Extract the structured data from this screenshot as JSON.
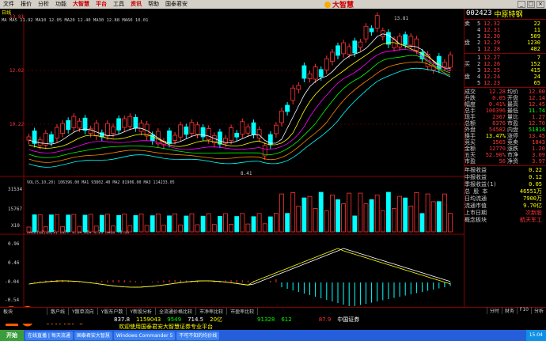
{
  "menu": {
    "items": [
      "文件",
      "报价",
      "分析",
      "功能",
      "大智慧",
      "平台",
      "工具",
      "资讯",
      "帮助",
      "国泰君安"
    ],
    "logo": "大智慧"
  },
  "chart": {
    "title": "日线",
    "ma_label": "MA MA5 11.92 MA10 12.05 MA20 12.40 MA30 12.88 MA60 10.01",
    "vol_label": "VOL(5,10,20)  106396.00  MA1 93802.40  MA2 81906.00  MA3 114233.05",
    "macd_label": "MACD(12,26,9)  DIFF 0.14  DEA 0.29  MACD -0.30",
    "price_axis": [
      "13.81",
      "12.02",
      "10.22"
    ],
    "vol_axis": [
      "31534",
      "15767",
      "X10"
    ],
    "macd_axis": [
      "0.96",
      "0.46",
      "-0.04",
      "-0.54"
    ],
    "high_label": "13.81",
    "low_label": "8.41"
  },
  "quote": {
    "code": "002423",
    "name": "中原特钢",
    "sell": [
      {
        "label": "卖",
        "idx": "5",
        "price": "12.32",
        "vol": "22"
      },
      {
        "label": "",
        "idx": "4",
        "price": "12.31",
        "vol": "11"
      },
      {
        "label": "",
        "idx": "3",
        "price": "12.30",
        "vol": "509"
      },
      {
        "label": "盘",
        "idx": "2",
        "price": "12.29",
        "vol": "1230"
      },
      {
        "label": "",
        "idx": "1",
        "price": "12.28",
        "vol": "482"
      }
    ],
    "buy": [
      {
        "label": "",
        "idx": "1",
        "price": "12.27",
        "vol": "7"
      },
      {
        "label": "买",
        "idx": "2",
        "price": "12.26",
        "vol": "152"
      },
      {
        "label": "",
        "idx": "3",
        "price": "12.25",
        "vol": "415"
      },
      {
        "label": "盘",
        "idx": "4",
        "price": "12.24",
        "vol": "24"
      },
      {
        "label": "",
        "idx": "5",
        "price": "12.23",
        "vol": "65"
      }
    ],
    "stats": [
      {
        "k": "成交",
        "v": "12.28",
        "k2": "均价",
        "v2": "12.00"
      },
      {
        "k": "升跌",
        "v": "0.05",
        "k2": "开盘",
        "v2": "12.14"
      },
      {
        "k": "幅度",
        "v": "0.41%",
        "k2": "最高",
        "v2": "12.45"
      },
      {
        "k": "总手",
        "v": "106396",
        "k2": "最低",
        "v2": "11.74"
      },
      {
        "k": "现手",
        "v": "2367",
        "k2": "量比",
        "v2": "1.27"
      },
      {
        "k": "总额",
        "v": "8376",
        "k2": "市盈",
        "v2": "12.70"
      },
      {
        "k": "外盘",
        "v": "54582",
        "k2": "内盘",
        "v2": "51814"
      },
      {
        "k": "换手",
        "v": "13.47%",
        "k2": "涨停",
        "v2": "13.45"
      },
      {
        "k": "竞买",
        "v": "1565",
        "k2": "竞卖",
        "v2": "1843"
      },
      {
        "k": "金额",
        "v": "12770",
        "k2": "涨跌",
        "v2": "1.20"
      },
      {
        "k": "五天",
        "v": "52.90%",
        "k2": "市净",
        "v2": "3.09"
      },
      {
        "k": "市盈",
        "v": "56",
        "k2": "净资",
        "v2": "3.97"
      }
    ],
    "fin": [
      {
        "k": "年报收益",
        "v": "0.22"
      },
      {
        "k": "中报收益",
        "v": "0.12"
      },
      {
        "k": "季报收益(1)",
        "v": "0.05"
      },
      {
        "k": "总 股 本",
        "v": "46551万"
      },
      {
        "k": "日均流通",
        "v": "7900万"
      },
      {
        "k": "流通市值",
        "v": "9.70亿"
      },
      {
        "k": "上市日期",
        "v": "次新股"
      },
      {
        "k": "概念板块",
        "v": "航天军工"
      }
    ],
    "extra": "中原"
  },
  "bottom_tabs": [
    "板块",
    "散户线",
    "Y散单流向",
    "Y股东户数",
    "Y新股分析",
    "全流通价格比较",
    "市净率比较",
    "市盈率比较"
  ],
  "right_tabs": [
    "分时",
    "财务",
    "F10",
    "分析"
  ],
  "ticker": {
    "a": "837.8",
    "b": "1159043",
    "c": "9549",
    "d": "714.5",
    "e": "20亿",
    "f": "91328",
    "g": "612",
    "h": "87.9",
    "i": "中国证券"
  },
  "marquee": "欢迎使用国泰君安大智慧证券专业平台",
  "taskbar": {
    "start": "开始",
    "tasks": [
      "在线直播 | 每天流通",
      "国泰君安大智慧",
      "Windows Commander 5",
      "不可不知的均价线"
    ],
    "clock": "15:04"
  },
  "watermark": "10拾荒网",
  "colors": {
    "up": "#ff3333",
    "down": "#00ffff",
    "bg": "#000000"
  }
}
